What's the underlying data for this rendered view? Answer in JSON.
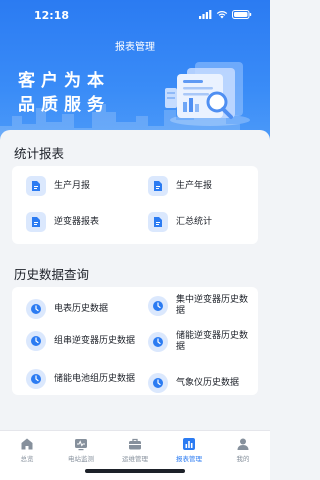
{
  "status": {
    "time": "12:18"
  },
  "header": {
    "title": "报表管理",
    "slogan_line1": "客户为本",
    "slogan_line2": "品质服务"
  },
  "stats": {
    "title": "统计报表",
    "items": [
      {
        "label": "生产月报",
        "icon": "document-icon"
      },
      {
        "label": "生产年报",
        "icon": "document-icon"
      },
      {
        "label": "逆变器报表",
        "icon": "document-icon"
      },
      {
        "label": "汇总统计",
        "icon": "document-icon"
      }
    ]
  },
  "history": {
    "title": "历史数据查询",
    "items": [
      {
        "label": "电表历史数据",
        "icon": "clock-icon"
      },
      {
        "label": "集中逆变器历史数据",
        "icon": "clock-icon"
      },
      {
        "label": "组串逆变器历史数据",
        "icon": "clock-icon"
      },
      {
        "label": "储能逆变器历史数据",
        "icon": "clock-icon"
      },
      {
        "label": "储能电池组历史数据",
        "icon": "clock-icon"
      },
      {
        "label": "气象仪历史数据",
        "icon": "clock-icon"
      }
    ]
  },
  "tabbar": {
    "tabs": [
      {
        "label": "总览",
        "icon": "home-icon"
      },
      {
        "label": "电站监测",
        "icon": "monitor-icon"
      },
      {
        "label": "运维管理",
        "icon": "briefcase-icon"
      },
      {
        "label": "报表管理",
        "icon": "bar-chart-icon"
      },
      {
        "label": "我的",
        "icon": "user-icon"
      }
    ],
    "active": "报表管理"
  },
  "colors": {
    "primary": "#2b7bf2",
    "icon_bg": "#dbe8fd",
    "inactive": "#86909c"
  }
}
